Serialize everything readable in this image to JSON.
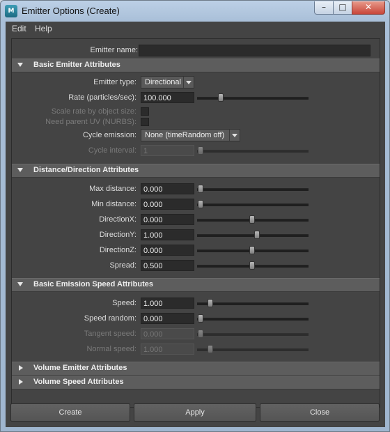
{
  "window": {
    "title": "Emitter Options (Create)",
    "app_icon_text": "M"
  },
  "menubar": {
    "items": [
      {
        "label": "Edit"
      },
      {
        "label": "Help"
      }
    ]
  },
  "emitter_name": {
    "label": "Emitter name:",
    "value": ""
  },
  "sections": {
    "basic": {
      "label": "Basic Emitter Attributes",
      "expanded": true
    },
    "distance": {
      "label": "Distance/Direction Attributes",
      "expanded": true
    },
    "speed": {
      "label": "Basic Emission Speed Attributes",
      "expanded": true
    },
    "volume_emitter": {
      "label": "Volume Emitter Attributes",
      "expanded": false
    },
    "volume_speed": {
      "label": "Volume Speed Attributes",
      "expanded": false
    }
  },
  "basic": {
    "emitter_type": {
      "label": "Emitter type:",
      "value": "Directional"
    },
    "rate": {
      "label": "Rate (particles/sec):",
      "value": "100.000",
      "slider_fraction": 0.2
    },
    "scale_rate": {
      "label": "Scale rate by object size:"
    },
    "need_parent_uv": {
      "label": "Need parent UV (NURBS):"
    },
    "cycle_emission": {
      "label": "Cycle emission:",
      "value": "None (timeRandom off)"
    },
    "cycle_interval": {
      "label": "Cycle interval:",
      "value": "1",
      "slider_fraction": 0.0
    }
  },
  "distance": {
    "max_distance": {
      "label": "Max distance:",
      "value": "0.000",
      "slider_fraction": 0.0
    },
    "min_distance": {
      "label": "Min distance:",
      "value": "0.000",
      "slider_fraction": 0.0
    },
    "direction_x": {
      "label": "DirectionX:",
      "value": "0.000",
      "slider_fraction": 0.5
    },
    "direction_y": {
      "label": "DirectionY:",
      "value": "1.000",
      "slider_fraction": 0.55
    },
    "direction_z": {
      "label": "DirectionZ:",
      "value": "0.000",
      "slider_fraction": 0.5
    },
    "spread": {
      "label": "Spread:",
      "value": "0.500",
      "slider_fraction": 0.5
    }
  },
  "speed": {
    "speed": {
      "label": "Speed:",
      "value": "1.000",
      "slider_fraction": 0.1
    },
    "speed_random": {
      "label": "Speed random:",
      "value": "0.000",
      "slider_fraction": 0.0
    },
    "tangent_speed": {
      "label": "Tangent speed:",
      "value": "0.000",
      "slider_fraction": 0.0
    },
    "normal_speed": {
      "label": "Normal speed:",
      "value": "1.000",
      "slider_fraction": 0.1
    }
  },
  "buttons": {
    "create": "Create",
    "apply": "Apply",
    "close": "Close"
  }
}
